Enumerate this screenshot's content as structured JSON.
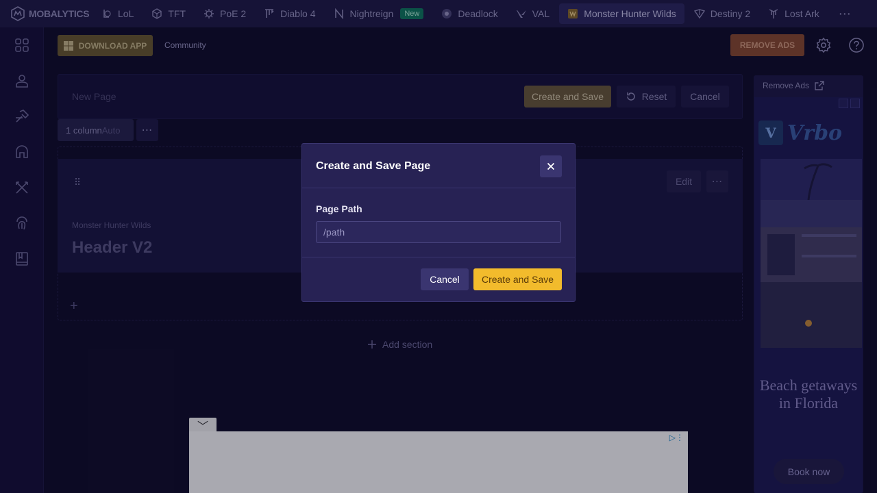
{
  "topnav": {
    "brand": "MOBALYTICS",
    "items": [
      {
        "label": "LoL",
        "icon": "lol-icon"
      },
      {
        "label": "TFT",
        "icon": "tft-icon"
      },
      {
        "label": "PoE 2",
        "icon": "poe2-icon"
      },
      {
        "label": "Diablo 4",
        "icon": "diablo4-icon"
      },
      {
        "label": "Nightreign",
        "icon": "nightreign-icon",
        "badge": "New"
      },
      {
        "label": "Deadlock",
        "icon": "deadlock-icon"
      },
      {
        "label": "VAL",
        "icon": "val-icon"
      },
      {
        "label": "Monster Hunter Wilds",
        "icon": "mhw-icon",
        "active": true
      },
      {
        "label": "Destiny 2",
        "icon": "destiny2-icon"
      },
      {
        "label": "Lost Ark",
        "icon": "lostark-icon"
      }
    ],
    "more": "⋯"
  },
  "sidebar": {
    "icons": [
      "grid-icon",
      "user-icon",
      "hammer-icon",
      "helmet-icon",
      "crossed-swords-icon",
      "fingerprint-icon",
      "book-icon"
    ]
  },
  "toolbar": {
    "download_label": "DOWNLOAD APP",
    "community_label": "Community",
    "remove_ads_label": "REMOVE ADS"
  },
  "editor": {
    "page_name_placeholder": "New Page",
    "create_save_label": "Create and Save",
    "reset_label": "Reset",
    "cancel_label": "Cancel",
    "column_value": "1 column",
    "column_mode": "Auto",
    "more": "⋯"
  },
  "section": {
    "drag": "⠿",
    "edit_label": "Edit",
    "more": "⋯",
    "subtitle": "Monster Hunter Wilds",
    "title": "Header V2",
    "add_block": "+",
    "add_section_label": "Add section"
  },
  "right_ad": {
    "remove_ads_label": "Remove Ads",
    "brand": "Vrbo",
    "brand_mark": "V",
    "headline": "Beach getaways in Florida",
    "cta": "Book now"
  },
  "bottom_ad": {
    "collapse": "﹀",
    "adchoices": "▷",
    "menu": "⋮"
  },
  "modal": {
    "title": "Create and Save Page",
    "field_label": "Page Path",
    "path_placeholder": "/path",
    "path_value": "",
    "cancel_label": "Cancel",
    "save_label": "Create and Save"
  },
  "colors": {
    "background": "#0f0c29",
    "accent": "#f2bb2c",
    "modal_bg": "#272254",
    "new_badge": "#0d7a5e"
  }
}
